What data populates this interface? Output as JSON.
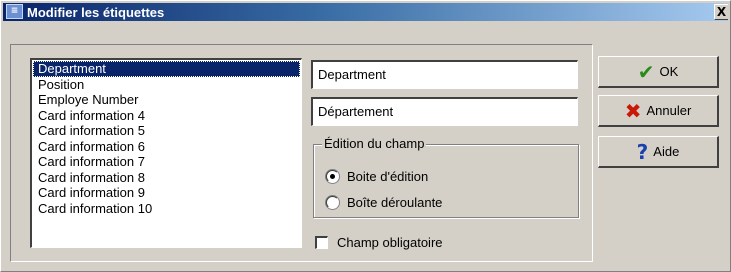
{
  "window": {
    "title": "Modifier les étiquettes",
    "icon_text": "≡",
    "close_label": "X",
    "accent": "#0a246a"
  },
  "labels_list": {
    "items": [
      "Department",
      "Position",
      "Employe Number",
      "Card information 4",
      "Card information 5",
      "Card information 6",
      "Card information 7",
      "Card information 8",
      "Card information 9",
      "Card information 10"
    ],
    "selected_index": 0
  },
  "fields": {
    "original_label": "Department",
    "translated_label": "Département"
  },
  "field_edit": {
    "group_title": "Édition du champ",
    "option_edit_box": "Boite d'édition",
    "option_dropdown": "Boîte déroulante",
    "selected": "option_edit_box"
  },
  "required_field": {
    "label": "Champ obligatoire",
    "checked": false
  },
  "buttons": {
    "ok": {
      "label": "OK",
      "icon": "checkmark-icon"
    },
    "cancel": {
      "label": "Annuler",
      "icon": "cross-icon"
    },
    "help": {
      "label": "Aide",
      "icon": "question-icon"
    }
  }
}
